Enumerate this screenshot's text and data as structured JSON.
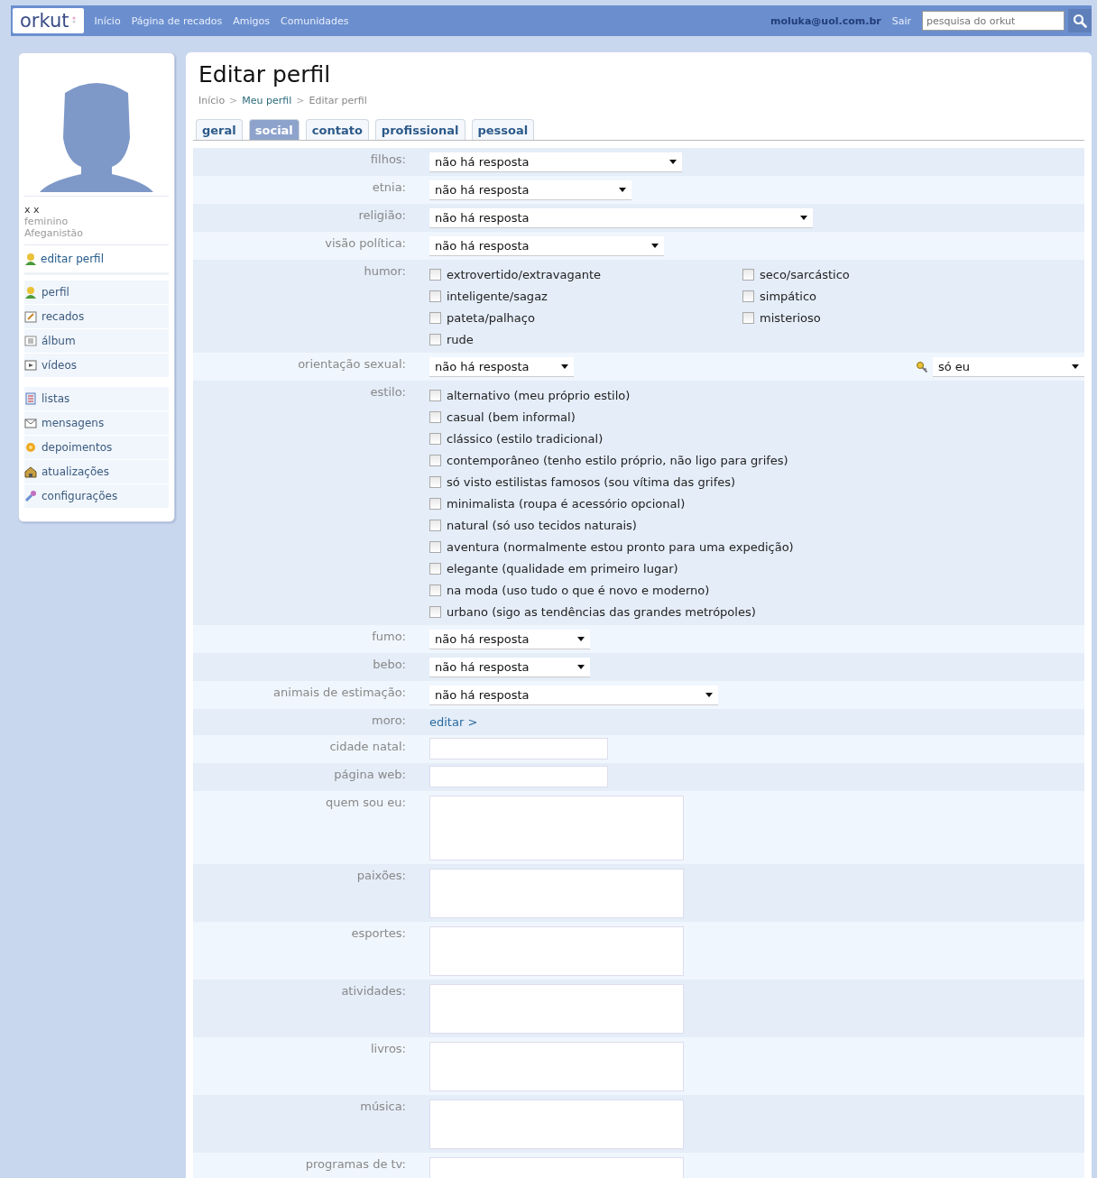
{
  "topbar": {
    "logo": "orkut",
    "nav": [
      "Início",
      "Página de recados",
      "Amigos",
      "Comunidades"
    ],
    "user": "moluka@uol.com.br",
    "logout": "Sair",
    "search": {
      "placeholder": "pesquisa do orkut"
    }
  },
  "sidebar": {
    "name": "x x",
    "gender": "feminino",
    "country": "Afeganistão",
    "edit_link": "editar perfil",
    "groups": [
      [
        "perfil",
        "recados",
        "álbum",
        "vídeos"
      ],
      [
        "listas",
        "mensagens",
        "depoimentos",
        "atualizações",
        "configurações"
      ]
    ]
  },
  "page": {
    "title": "Editar perfil",
    "separator": ">",
    "breadcrumb": [
      {
        "label": "Início",
        "link": false
      },
      {
        "label": "Meu perfil",
        "link": true
      },
      {
        "label": "Editar perfil",
        "link": false
      }
    ],
    "tabs": [
      {
        "label": "geral",
        "selected": false
      },
      {
        "label": "social",
        "selected": true
      },
      {
        "label": "contato",
        "selected": false
      },
      {
        "label": "profissional",
        "selected": false
      },
      {
        "label": "pessoal",
        "selected": false
      }
    ],
    "rows": [
      {
        "kind": "select",
        "label": "filhos:",
        "value": "não há resposta"
      },
      {
        "kind": "select",
        "label": "etnia:",
        "value": "não há resposta"
      },
      {
        "kind": "select",
        "label": "religião:",
        "value": "não há resposta"
      },
      {
        "kind": "select",
        "label": "visão política:",
        "value": "não há resposta"
      },
      {
        "kind": "checkboxes",
        "label": "humor:",
        "columns": [
          [
            {
              "label": "extrovertido/extravagante",
              "checked": false
            },
            {
              "label": "inteligente/sagaz",
              "checked": false
            },
            {
              "label": "pateta/palhaço",
              "checked": false
            },
            {
              "label": "rude",
              "checked": false
            }
          ],
          [
            {
              "label": "seco/sarcástico",
              "checked": false
            },
            {
              "label": "simpático",
              "checked": false
            },
            {
              "label": "misterioso",
              "checked": false
            }
          ]
        ]
      },
      {
        "kind": "select",
        "label": "orientação sexual:",
        "value": "não há resposta",
        "privacy": "só eu"
      },
      {
        "kind": "checkboxes",
        "label": "estilo:",
        "columns": [
          [
            {
              "label": "alternativo (meu próprio estilo)",
              "checked": false
            },
            {
              "label": "casual (bem informal)",
              "checked": false
            },
            {
              "label": "clássico (estilo tradicional)",
              "checked": false
            },
            {
              "label": "contemporâneo (tenho estilo próprio, não ligo para grifes)",
              "checked": false
            },
            {
              "label": "só visto estilistas famosos (sou vítima das grifes)",
              "checked": false
            },
            {
              "label": "minimalista (roupa é acessório opcional)",
              "checked": false
            },
            {
              "label": "natural (só uso tecidos naturais)",
              "checked": false
            },
            {
              "label": "aventura (normalmente estou pronto para uma expedição)",
              "checked": false
            },
            {
              "label": "elegante (qualidade em primeiro lugar)",
              "checked": false
            },
            {
              "label": "na moda (uso tudo o que é novo e moderno)",
              "checked": false
            },
            {
              "label": "urbano (sigo as tendências das grandes metrópoles)",
              "checked": false
            }
          ]
        ]
      },
      {
        "kind": "select",
        "label": "fumo:",
        "value": "não há resposta"
      },
      {
        "kind": "select",
        "label": "bebo:",
        "value": "não há resposta"
      },
      {
        "kind": "select",
        "label": "animais de estimação:",
        "value": "não há resposta"
      },
      {
        "kind": "link",
        "label": "moro:",
        "value": "editar >"
      },
      {
        "kind": "text",
        "label": "cidade natal:"
      },
      {
        "kind": "text",
        "label": "página web:"
      },
      {
        "kind": "textarea",
        "label": "quem sou eu:"
      },
      {
        "kind": "textarea",
        "label": "paixões:"
      },
      {
        "kind": "textarea",
        "label": "esportes:"
      },
      {
        "kind": "textarea",
        "label": "atividades:"
      },
      {
        "kind": "textarea",
        "label": "livros:"
      },
      {
        "kind": "textarea",
        "label": "música:"
      },
      {
        "kind": "textarea",
        "label": "programas de tv:"
      }
    ]
  }
}
